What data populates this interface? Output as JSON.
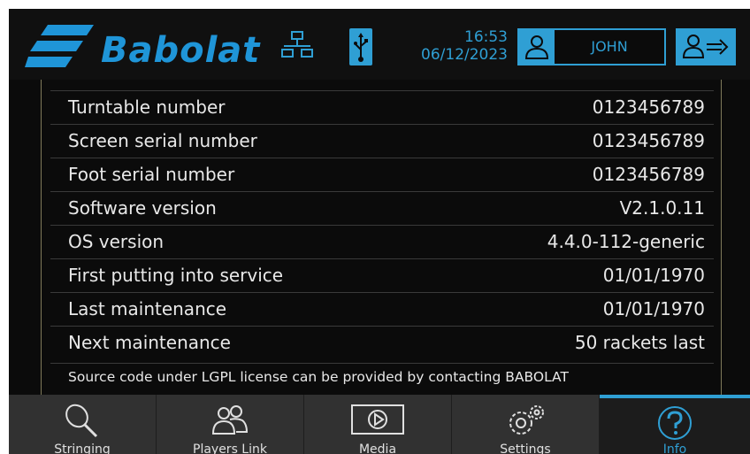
{
  "header": {
    "brand": "Babolat",
    "time": "16:53",
    "date": "06/12/2023",
    "user_name": "JOHN",
    "icons": [
      "network-icon",
      "usb-icon",
      "user-icon",
      "logout-icon"
    ]
  },
  "info": {
    "rows": [
      {
        "label": "Turntable number",
        "value": "0123456789"
      },
      {
        "label": "Screen serial number",
        "value": "0123456789"
      },
      {
        "label": "Foot serial number",
        "value": "0123456789"
      },
      {
        "label": "Software version",
        "value": "V2.1.0.11"
      },
      {
        "label": "OS version",
        "value": "4.4.0-112-generic"
      },
      {
        "label": "First putting into service",
        "value": "01/01/1970"
      },
      {
        "label": "Last maintenance",
        "value": "01/01/1970"
      },
      {
        "label": "Next maintenance",
        "value": "50 rackets last"
      }
    ],
    "note": "Source code under LGPL license can be provided by contacting BABOLAT"
  },
  "nav": {
    "tabs": [
      {
        "label": "Stringing",
        "icon": "racket-icon"
      },
      {
        "label": "Players Link",
        "icon": "players-icon"
      },
      {
        "label": "Media",
        "icon": "play-icon"
      },
      {
        "label": "Settings",
        "icon": "gears-icon"
      },
      {
        "label": "Info",
        "icon": "help-icon",
        "active": true
      }
    ]
  },
  "colors": {
    "accent": "#2f9fd4",
    "background": "#0b0b0b",
    "nav": "#313131"
  }
}
